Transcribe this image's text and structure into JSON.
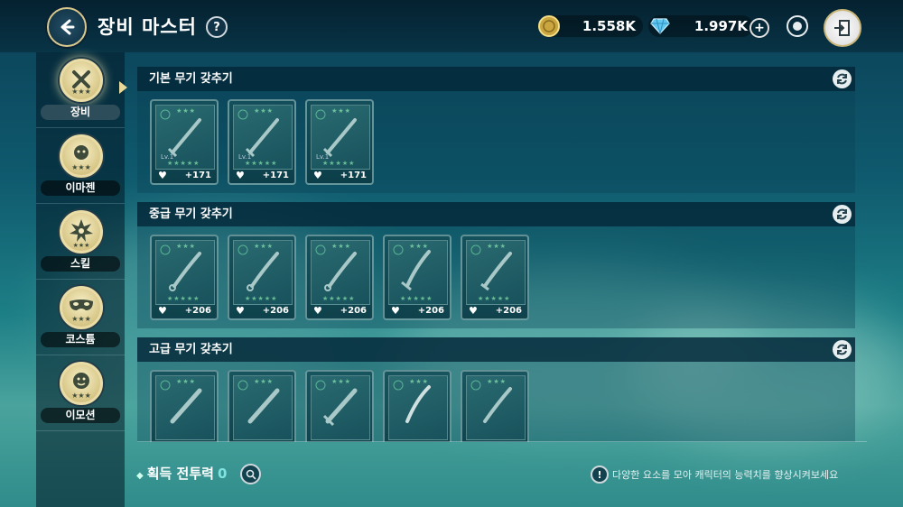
{
  "header": {
    "title": "장비 마스터",
    "help_label": "?",
    "gold": "1.558K",
    "diamond": "1.997K",
    "plus_label": "+"
  },
  "sidebar": {
    "items": [
      {
        "label": "장비",
        "icon": "equipment-icon"
      },
      {
        "label": "이마젠",
        "icon": "imagen-icon"
      },
      {
        "label": "스킬",
        "icon": "skill-icon"
      },
      {
        "label": "코스튬",
        "icon": "costume-icon"
      },
      {
        "label": "이모션",
        "icon": "emotion-icon"
      }
    ]
  },
  "sections": [
    {
      "title": "기본 무기 갖추기",
      "cards": [
        {
          "value": "+171"
        },
        {
          "value": "+171"
        },
        {
          "value": "+171"
        }
      ]
    },
    {
      "title": "중급 무기 갖추기",
      "cards": [
        {
          "value": "+206"
        },
        {
          "value": "+206"
        },
        {
          "value": "+206"
        },
        {
          "value": "+206"
        },
        {
          "value": "+206"
        }
      ]
    },
    {
      "title": "고급 무기 갖추기",
      "cards": [
        {},
        {},
        {},
        {},
        {}
      ]
    }
  ],
  "card_text": {
    "lv": "Lv.1",
    "stars": "★★★★★",
    "top_stars": "★★★"
  },
  "footer": {
    "power_label": "획득 전투력",
    "power_value": "0",
    "hint_icon": "!",
    "hint": "다양한 요소를 모아 캐릭터의 능력치를 향상시켜보세요"
  },
  "colors": {
    "accent": "#7fe3e0",
    "gold": "#e8d89a"
  }
}
